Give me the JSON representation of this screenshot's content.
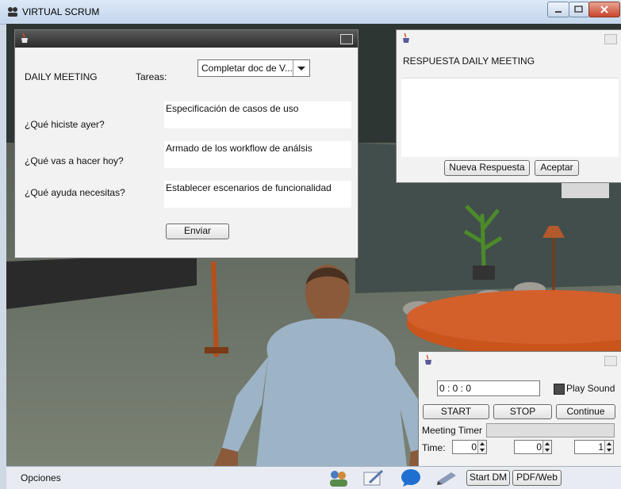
{
  "window": {
    "title": "VIRTUAL SCRUM"
  },
  "daily_panel": {
    "heading": "DAILY MEETING",
    "tareas_label": "Tareas:",
    "tareas_value": "Completar doc de V...",
    "q1_label": "¿Qué hiciste ayer?",
    "q1_value": "Especificación de casos de uso",
    "q2_label": "¿Qué vas a hacer hoy?",
    "q2_value": "Armado de los workflow de análsis",
    "q3_label": "¿Qué ayuda necesitas?",
    "q3_value": "Establecer escenarios de funcionalidad",
    "send_label": "Enviar"
  },
  "response_panel": {
    "heading": "RESPUESTA DAILY MEETING",
    "new_label": "Nueva Respuesta",
    "accept_label": "Aceptar"
  },
  "timer_panel": {
    "time_display": "0 : 0 : 0",
    "play_sound_label": "Play Sound",
    "start_label": "START",
    "stop_label": "STOP",
    "continue_label": "Continue",
    "meeting_timer_label": "Meeting Timer",
    "time_label": "Time:",
    "spin_values": [
      "0",
      "0",
      "1"
    ]
  },
  "statusbar": {
    "options_label": "Opciones",
    "start_dm_label": "Start DM",
    "pdf_label": "PDF/Web",
    "icons": [
      "users-icon",
      "notepad-icon",
      "chat-bubble-icon",
      "pen-icon"
    ]
  },
  "colors": {
    "table": "#c9541c",
    "grass": "#6f776a",
    "shirt": "#9db3c6"
  }
}
